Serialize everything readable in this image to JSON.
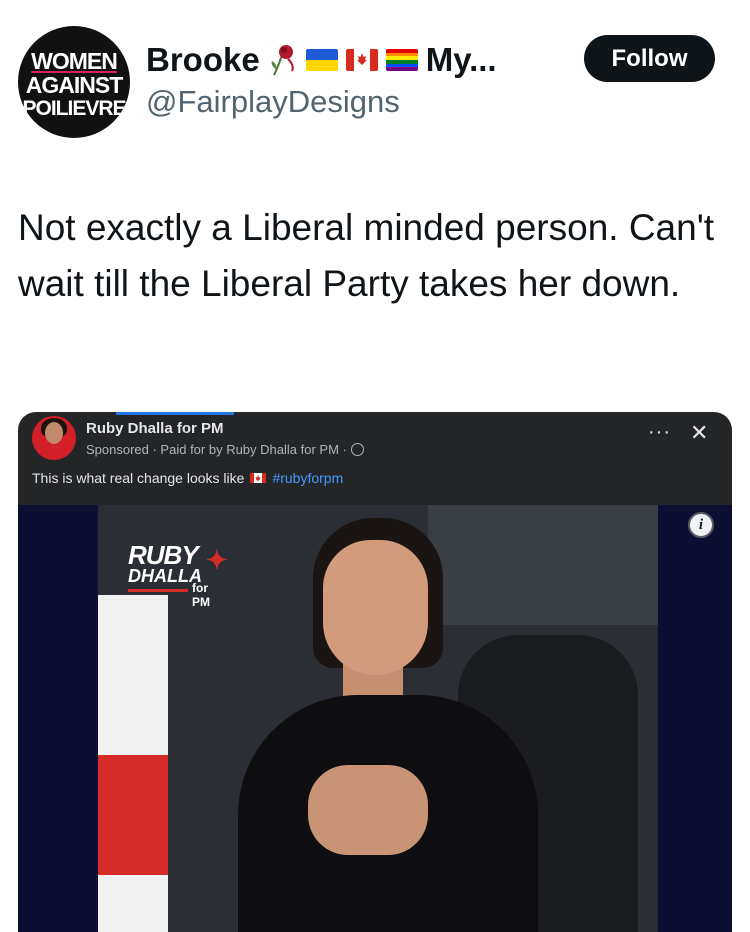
{
  "post": {
    "avatar": {
      "line1": "WOMEN",
      "line2": "AGAINST",
      "line3": "POILIEVRE"
    },
    "display_name": "Brooke",
    "display_name_suffix": "My...",
    "emoji_icons": [
      "wilted-rose-icon",
      "ukraine-flag-icon",
      "canada-flag-icon",
      "rainbow-flag-icon"
    ],
    "handle": "@FairplayDesigns",
    "follow_label": "Follow",
    "text": "Not exactly a Liberal minded person. Can't wait till the Liberal Party takes her down."
  },
  "ad": {
    "page_name": "Ruby Dhalla for PM",
    "sponsored": "Sponsored · Paid for by Ruby Dhalla for PM ·",
    "caption": "This is what real change looks like",
    "hashtag": "#rubyforpm",
    "menu_icon": "more-dots-icon",
    "close_icon": "close-icon",
    "info_label": "i",
    "logo": {
      "line1": "RUBY",
      "line2": "DHALLA",
      "line3": "for PM"
    }
  },
  "colors": {
    "follow_bg": "#0f1419",
    "handle": "#536471",
    "hashtag": "#4599ff",
    "ad_bg": "#242526"
  }
}
